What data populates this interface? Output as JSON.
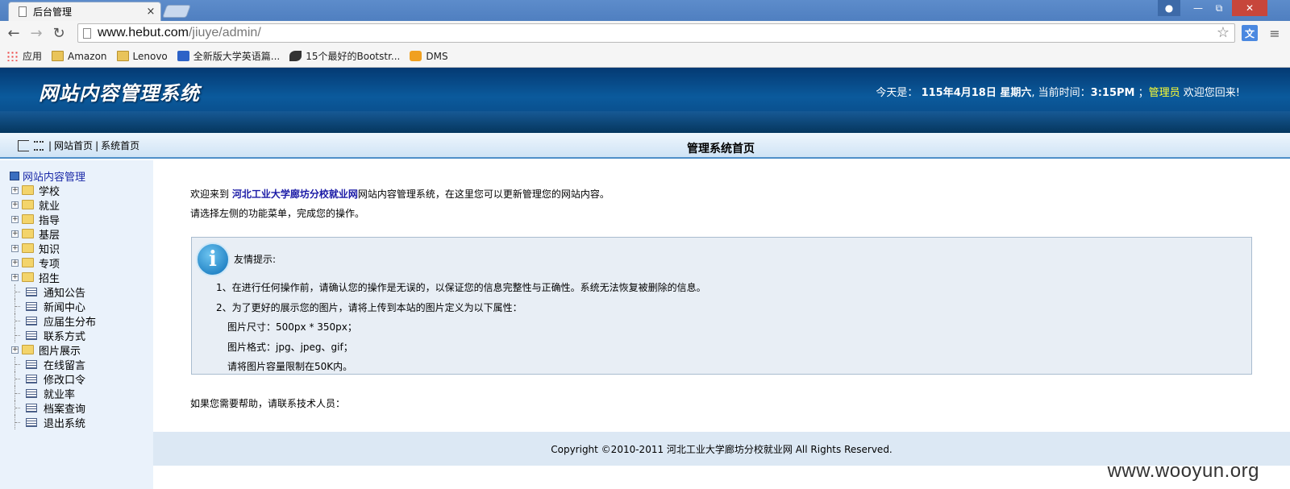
{
  "browser": {
    "tab_title": "后台管理",
    "tab_close": "×",
    "url_host": "www.hebut.com",
    "url_path": "/jiuye/admin/",
    "bookmarks": [
      "应用",
      "Amazon",
      "Lenovo",
      "全新版大学英语篇...",
      "15个最好的Bootstr...",
      "DMS"
    ]
  },
  "header": {
    "title": "网站内容管理系统",
    "today_label": "今天是：",
    "date": "115年4月18日 星期六",
    "time_label": ", 当前时间：",
    "time": "3:15PM",
    "sep": "；",
    "user": "管理员",
    "welcome": "欢迎您回来!"
  },
  "crumb": {
    "home_link": "网站首页",
    "sys_link": "系统首页",
    "page_title": "管理系统首页"
  },
  "sidebar": {
    "root": "网站内容管理",
    "items": [
      {
        "label": "学校",
        "type": "folder"
      },
      {
        "label": "就业",
        "type": "folder"
      },
      {
        "label": "指导",
        "type": "folder"
      },
      {
        "label": "基层",
        "type": "folder"
      },
      {
        "label": "知识",
        "type": "folder"
      },
      {
        "label": "专项",
        "type": "folder"
      },
      {
        "label": "招生",
        "type": "folder"
      },
      {
        "label": "通知公告",
        "type": "doc"
      },
      {
        "label": "新闻中心",
        "type": "doc"
      },
      {
        "label": "应届生分布",
        "type": "doc"
      },
      {
        "label": "联系方式",
        "type": "doc"
      },
      {
        "label": "图片展示",
        "type": "folder"
      },
      {
        "label": "在线留言",
        "type": "doc"
      },
      {
        "label": "修改口令",
        "type": "doc"
      },
      {
        "label": "就业率",
        "type": "doc"
      },
      {
        "label": "档案查询",
        "type": "doc"
      },
      {
        "label": "退出系统",
        "type": "doc"
      }
    ]
  },
  "main": {
    "intro_prefix": "欢迎来到",
    "site_name": "河北工业大学廊坊分校就业网",
    "intro_suffix": "网站内容管理系统，在这里您可以更新管理您的网站内容。",
    "intro_line2": "请选择左侧的功能菜单，完成您的操作。",
    "tip_title": "友情提示:",
    "tip_1": "1、在进行任何操作前，请确认您的操作是无误的，以保证您的信息完整性与正确性。系统无法恢复被删除的信息。",
    "tip_2": "2、为了更好的展示您的图片，请将上传到本站的图片定义为以下属性：",
    "tip_size": "图片尺寸：500px * 350px；",
    "tip_format": "图片格式：jpg、jpeg、gif；",
    "tip_limit": "请将图片容量限制在50K内。",
    "help": "如果您需要帮助，请联系技术人员："
  },
  "footer": {
    "copyright": "Copyright ©2010-2011 河北工业大学廊坊分校就业网 All Rights Reserved."
  },
  "watermark": "www.wooyun.org"
}
